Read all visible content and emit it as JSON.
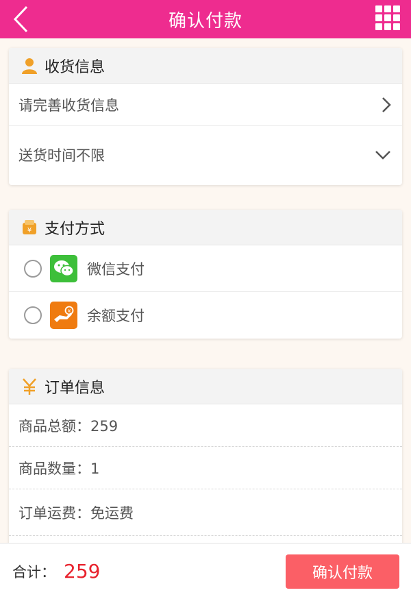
{
  "header": {
    "title": "确认付款"
  },
  "colors": {
    "brand": "#ee2c8f",
    "accent_price": "#e8222d",
    "confirm_button": "#fb5f66",
    "icon_orange": "#f0a028",
    "wechat_green": "#3dbf3a",
    "balance_orange": "#ef7b10"
  },
  "shipping": {
    "title": "收货信息",
    "address_placeholder": "请完善收货信息",
    "delivery_time": "送货时间不限"
  },
  "payment": {
    "title": "支付方式",
    "methods": [
      {
        "label": "微信支付",
        "icon": "wechat-pay-icon",
        "selected": false
      },
      {
        "label": "余额支付",
        "icon": "balance-pay-icon",
        "selected": false
      }
    ]
  },
  "order": {
    "title": "订单信息",
    "lines": [
      {
        "text": "商品总额：259"
      },
      {
        "text": "商品数量：1"
      },
      {
        "text": "订单运费：免运费"
      }
    ]
  },
  "footer": {
    "total_label": "合计：",
    "total_value": "259",
    "confirm_label": "确认付款"
  }
}
